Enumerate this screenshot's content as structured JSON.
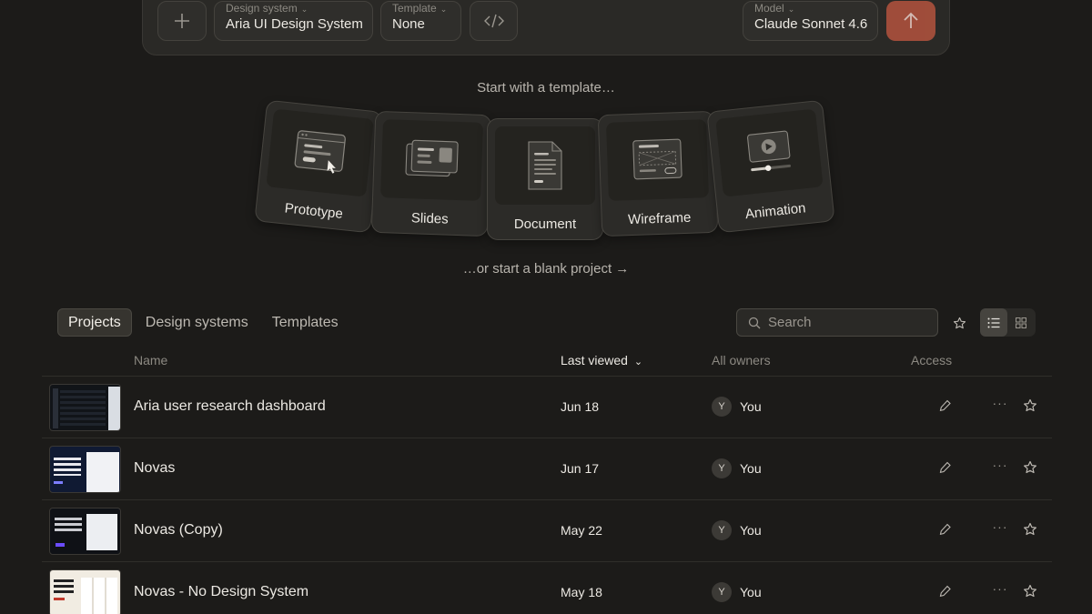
{
  "composer": {
    "design_system_label": "Design system",
    "design_system_value": "Aria UI Design System",
    "template_label": "Template",
    "template_value": "None",
    "model_label": "Model",
    "model_value": "Claude Sonnet 4.6",
    "icons": [
      "plus-icon",
      "code-icon",
      "arrow-up-icon",
      "chevron-down-icon"
    ],
    "send_color": "#b4533e"
  },
  "templates": {
    "heading": "Start with a template…",
    "cards": [
      {
        "label": "Prototype",
        "icon": "prototype-icon"
      },
      {
        "label": "Slides",
        "icon": "slides-icon"
      },
      {
        "label": "Document",
        "icon": "document-icon"
      },
      {
        "label": "Wireframe",
        "icon": "wireframe-icon"
      },
      {
        "label": "Animation",
        "icon": "animation-icon"
      }
    ],
    "blank_link": "…or start a blank project →"
  },
  "tabs": [
    {
      "label": "Projects",
      "active": true
    },
    {
      "label": "Design systems",
      "active": false
    },
    {
      "label": "Templates",
      "active": false
    }
  ],
  "search": {
    "placeholder": "Search"
  },
  "table": {
    "columns": {
      "name": "Name",
      "last_viewed": "Last viewed",
      "owners": "All owners",
      "access": "Access"
    },
    "rows": [
      {
        "name": "Aria user research dashboard",
        "date": "Jun 18",
        "avatar": "Y",
        "owner": "You"
      },
      {
        "name": "Novas",
        "date": "Jun 17",
        "avatar": "Y",
        "owner": "You"
      },
      {
        "name": "Novas (Copy)",
        "date": "May 22",
        "avatar": "Y",
        "owner": "You"
      },
      {
        "name": "Novas - No Design System",
        "date": "May 18",
        "avatar": "Y",
        "owner": "You"
      }
    ]
  }
}
